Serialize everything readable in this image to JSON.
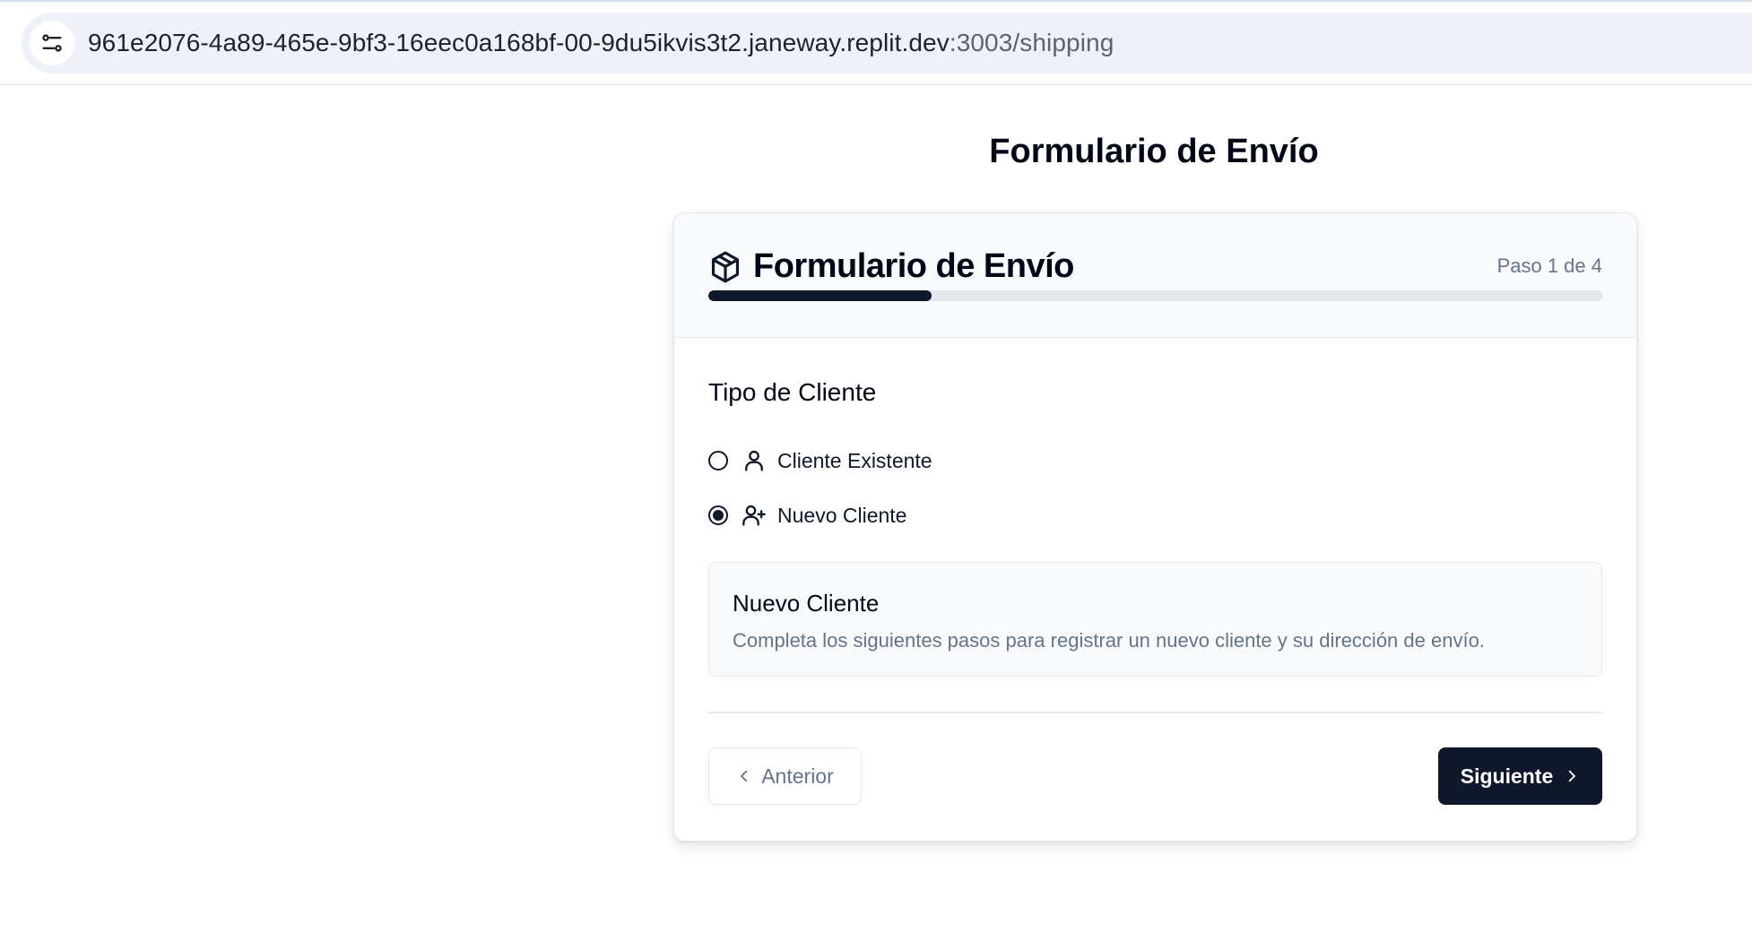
{
  "browser": {
    "url_host": "961e2076-4a89-465e-9bf3-16eec0a168bf-00-9du5ikvis3t2.janeway.replit.dev",
    "url_path": ":3003/shipping",
    "site_icon": "tune-icon"
  },
  "page": {
    "title": "Formulario de Envío"
  },
  "form": {
    "title": "Formulario de Envío",
    "title_icon": "package-icon",
    "step_text": "Paso 1 de 4",
    "progress_percent": 25,
    "section_title": "Tipo de Cliente",
    "options": [
      {
        "label": "Cliente Existente",
        "icon": "user-icon",
        "selected": false
      },
      {
        "label": "Nuevo Cliente",
        "icon": "user-plus-icon",
        "selected": true
      }
    ],
    "info": {
      "title": "Nuevo Cliente",
      "description": "Completa los siguientes pasos para registrar un nuevo cliente y su dirección de envío."
    },
    "buttons": {
      "previous": "Anterior",
      "next": "Siguiente"
    }
  },
  "colors": {
    "primary": "#0f172a",
    "muted_text": "#64748b",
    "border": "#e5e7eb",
    "header_bg": "#f8fafc"
  }
}
